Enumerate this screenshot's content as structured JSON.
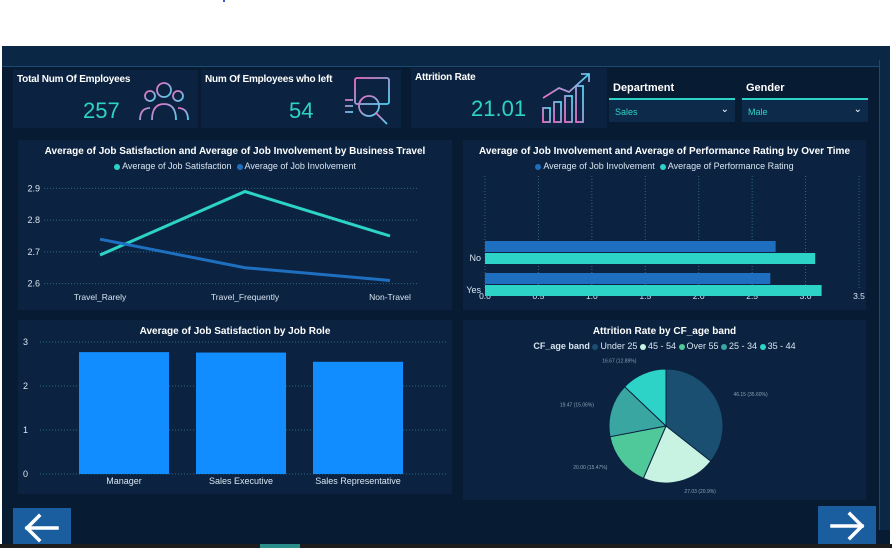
{
  "kpis": {
    "total": {
      "title": "Total Num Of Employees",
      "value": "257",
      "icon": "people-icon"
    },
    "left": {
      "title": "Num Of Employees who left",
      "value": "54",
      "icon": "magnifier-chart-icon"
    },
    "attrition": {
      "title": "Attrition Rate",
      "value": "21.01",
      "icon": "bar-growth-icon"
    }
  },
  "slicers": {
    "department": {
      "label": "Department",
      "value": "Sales"
    },
    "gender": {
      "label": "Gender",
      "value": "Male"
    }
  },
  "charts": {
    "travel": {
      "title": "Average of Job Satisfaction and Average of Job Involvement by Business Travel",
      "legend": [
        {
          "name": "Average of Job Satisfaction",
          "color": "#2ed3c7"
        },
        {
          "name": "Average of Job Involvement",
          "color": "#1e6fc0"
        }
      ]
    },
    "overtime": {
      "title": "Average of Job Involvement and Average of Performance Rating by Over Time",
      "legend": [
        {
          "name": "Average of Job Involvement",
          "color": "#1e6fc0"
        },
        {
          "name": "Average of Performance Rating",
          "color": "#2ed3c7"
        }
      ]
    },
    "role": {
      "title": "Average of Job Satisfaction by Job Role"
    },
    "age": {
      "title": "Attrition Rate by CF_age band",
      "legend_title": "CF_age band",
      "legend": [
        {
          "name": "Under 25",
          "color": "#1b4f72"
        },
        {
          "name": "45 - 54",
          "color": "#c8f3e2"
        },
        {
          "name": "Over 55",
          "color": "#4fc99a"
        },
        {
          "name": "25 - 34",
          "color": "#3aa6a1"
        },
        {
          "name": "35 - 44",
          "color": "#2ed3c7"
        }
      ]
    }
  },
  "chart_data": [
    {
      "type": "line",
      "title": "Average of Job Satisfaction and Average of Job Involvement by Business Travel",
      "categories": [
        "Travel_Rarely",
        "Travel_Frequently",
        "Non-Travel"
      ],
      "series": [
        {
          "name": "Average of Job Satisfaction",
          "values": [
            2.69,
            2.89,
            2.75
          ],
          "color": "#2ed3c7"
        },
        {
          "name": "Average of Job Involvement",
          "values": [
            2.74,
            2.65,
            2.61
          ],
          "color": "#1e6fc0"
        }
      ],
      "ylim": [
        2.58,
        2.92
      ],
      "yticks": [
        "2.6",
        "2.7",
        "2.8",
        "2.9"
      ],
      "ytick_values": [
        2.6,
        2.7,
        2.8,
        2.9
      ],
      "legend": "top"
    },
    {
      "type": "bar",
      "orientation": "horizontal",
      "title": "Average of Job Involvement and Average of Performance Rating by Over Time",
      "categories": [
        "No",
        "Yes"
      ],
      "series": [
        {
          "name": "Average of Job Involvement",
          "values": [
            2.72,
            2.67
          ],
          "color": "#1e6fc0"
        },
        {
          "name": "Average of Performance Rating",
          "values": [
            3.09,
            3.15
          ],
          "color": "#2ed3c7"
        }
      ],
      "xlim": [
        0,
        3.5
      ],
      "xticks": [
        "0.0",
        "0.5",
        "1.0",
        "1.5",
        "2.0",
        "2.5",
        "3.0",
        "3.5"
      ],
      "xtick_values": [
        0,
        0.5,
        1,
        1.5,
        2,
        2.5,
        3,
        3.5
      ],
      "legend": "top"
    },
    {
      "type": "bar",
      "title": "Average of Job Satisfaction by Job Role",
      "categories": [
        "Manager",
        "Sales Executive",
        "Sales Representative"
      ],
      "values": [
        2.77,
        2.76,
        2.55
      ],
      "color": "#118dff",
      "ylim": [
        0,
        3
      ],
      "yticks": [
        "0",
        "1",
        "2",
        "3"
      ],
      "ytick_values": [
        0,
        1,
        2,
        3
      ]
    },
    {
      "type": "pie",
      "title": "Attrition Rate by CF_age band",
      "categories": [
        "Under 25",
        "45 - 54",
        "Over 55",
        "25 - 34",
        "35 - 44"
      ],
      "values": [
        35.6,
        20.9,
        15.5,
        15.1,
        12.9
      ],
      "labels": [
        "46.15 (35.60%)",
        "27.03 (20.9%)",
        "20.00 (15.47%)",
        "19.47 (15.06%)",
        "16.67 (12.89%)"
      ],
      "colors": [
        "#1b4f72",
        "#c8f3e2",
        "#4fc99a",
        "#3aa6a1",
        "#2ed3c7"
      ],
      "legend": "top"
    }
  ]
}
